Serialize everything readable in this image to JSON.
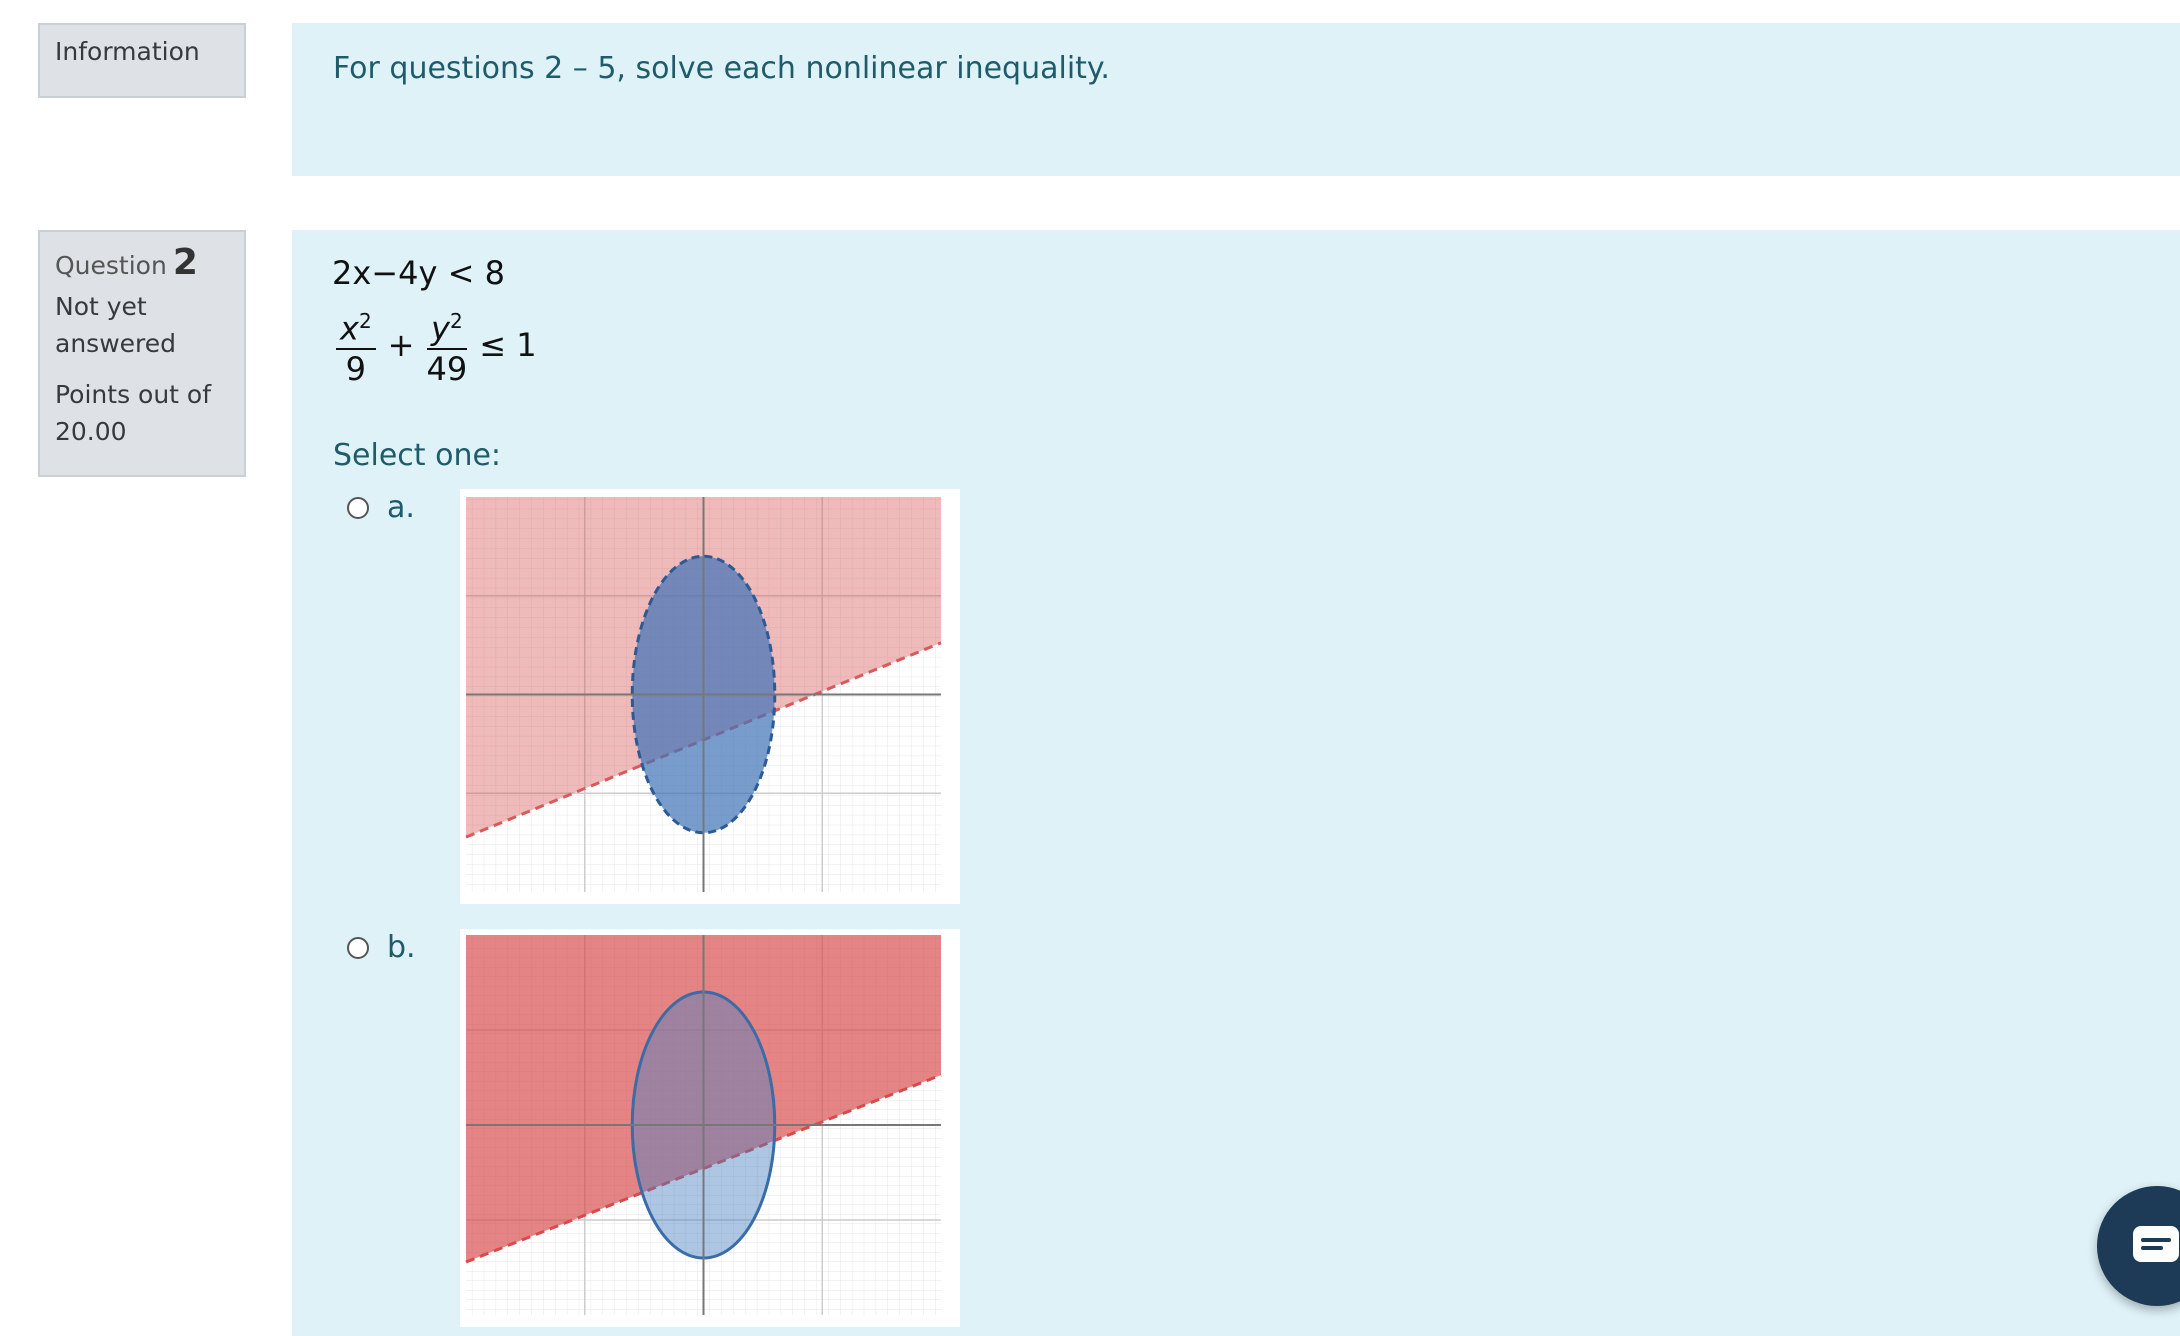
{
  "info": {
    "label": "Information",
    "text": "For questions 2 – 5, solve each nonlinear inequality."
  },
  "question": {
    "label": "Question",
    "number": "2",
    "state": "Not yet answered",
    "points": "Points out of 20.00",
    "equation1": "2x−4y < 8",
    "equation2": {
      "term1_num": "x2",
      "term1_den": "9",
      "plus": "+",
      "term2_num": "y2",
      "term2_den": "49",
      "rel": "≤ 1"
    },
    "prompt": "Select one:",
    "options": [
      {
        "label": "a.",
        "selected": false
      },
      {
        "label": "b.",
        "selected": false
      }
    ]
  },
  "colors": {
    "panel": "#def2f8",
    "sidebar": "#dee2e6",
    "accent_text": "#1f5c6a",
    "red_region": "#e06b6b",
    "blue_region": "#4a7fc1"
  },
  "icons": {
    "chat": "chat-icon"
  }
}
